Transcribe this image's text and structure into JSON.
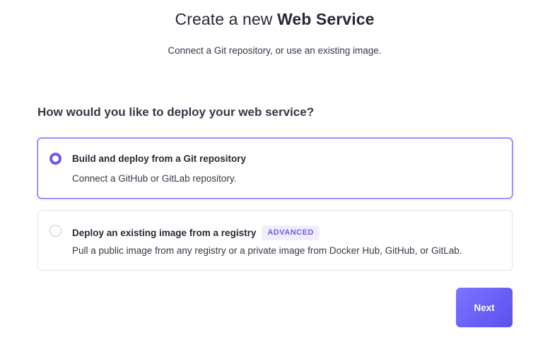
{
  "header": {
    "title_prefix": "Create a new ",
    "title_strong": "Web Service",
    "subtitle": "Connect a Git repository, or use an existing image."
  },
  "question": "How would you like to deploy your web service?",
  "options": [
    {
      "title": "Build and deploy from a Git repository",
      "description": "Connect a GitHub or GitLab repository.",
      "selected": true
    },
    {
      "title": "Deploy an existing image from a registry",
      "badge": "ADVANCED",
      "description": "Pull a public image from any registry or a private image from Docker Hub, GitHub, or GitLab.",
      "selected": false
    }
  ],
  "actions": {
    "next_label": "Next"
  },
  "colors": {
    "accent": "#6c5ce7",
    "button_gradient_start": "#7b74ff",
    "button_gradient_end": "#5b4ff0",
    "badge_bg": "#f0eefc"
  }
}
